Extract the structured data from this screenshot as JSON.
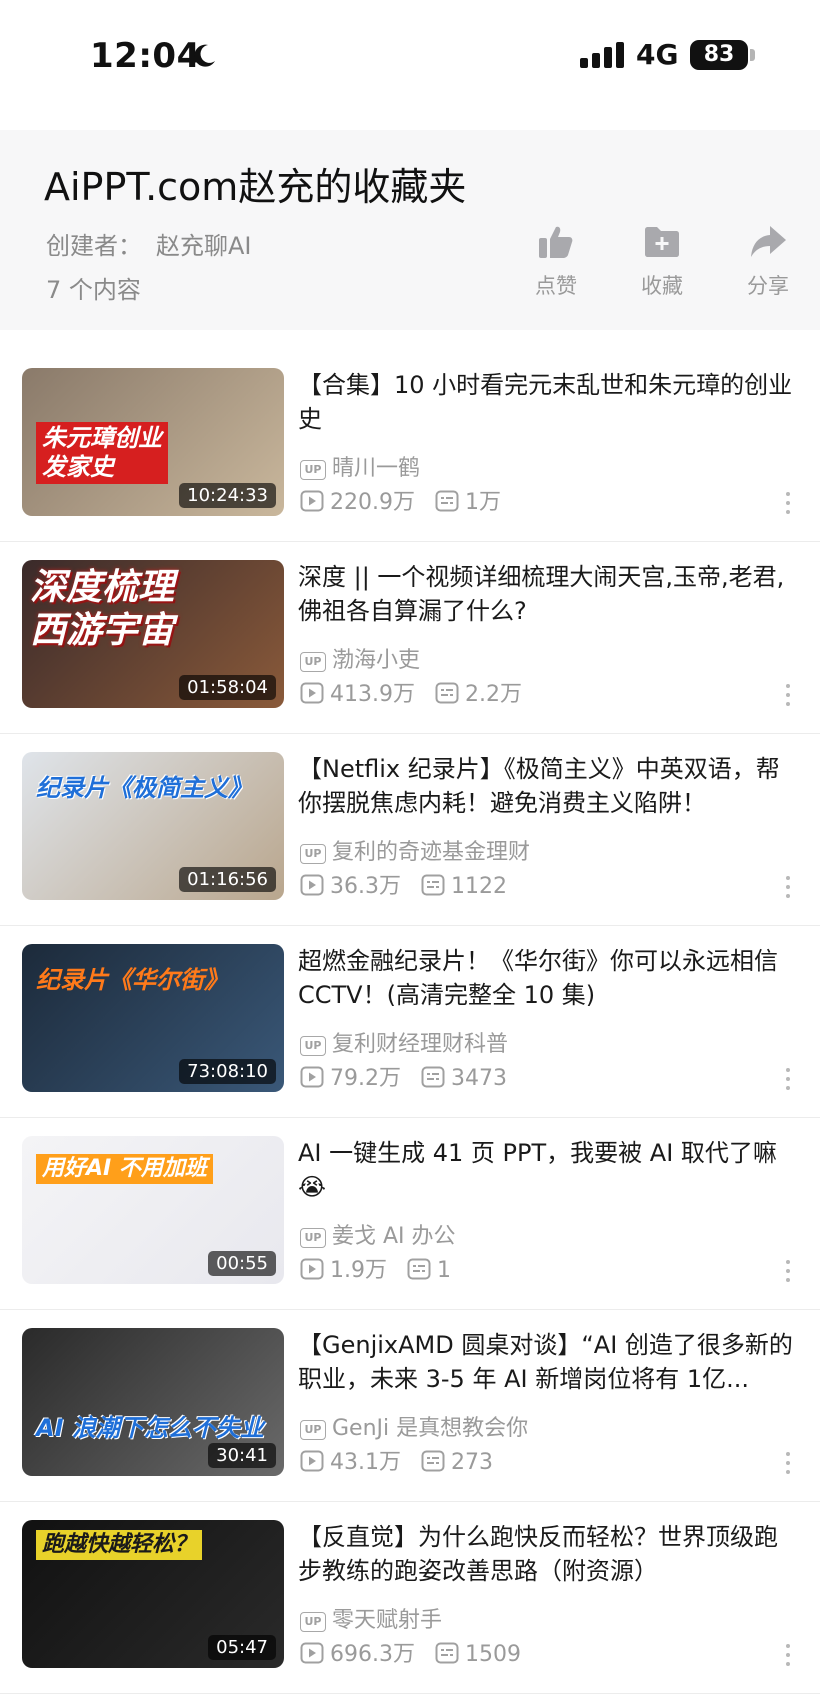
{
  "status_bar": {
    "time": "12:04",
    "network": "4G",
    "battery": "83"
  },
  "header": {
    "title": "AiPPT.com赵充的收藏夹",
    "creator_label": "创建者：",
    "creator_name": "赵充聊AI",
    "item_count": "7 个内容",
    "actions": [
      {
        "label": "点赞",
        "icon": "thumbs-up-icon"
      },
      {
        "label": "收藏",
        "icon": "folder-add-icon"
      },
      {
        "label": "分享",
        "icon": "share-arrow-icon"
      }
    ]
  },
  "videos": [
    {
      "title": "【合集】10 小时看完元末乱世和朱元璋的创业史",
      "uploader": "晴川一鹤",
      "views": "220.9万",
      "comments": "1万",
      "duration": "10:24:33",
      "thumb_caption": "朱元璋创业\n发家史",
      "thumb_colors": [
        "#8a7a6a",
        "#c9b79c"
      ]
    },
    {
      "title": "深度 || 一个视频详细梳理大闹天宫,玉帝,老君,佛祖各自算漏了什么?",
      "uploader": "渤海小吏",
      "views": "413.9万",
      "comments": "2.2万",
      "duration": "01:58:04",
      "thumb_caption": "深度梳理\n西游宇宙",
      "thumb_colors": [
        "#3a2a2a",
        "#8a5a3a"
      ]
    },
    {
      "title": "【Netflix 纪录片】《极简主义》中英双语，帮你摆脱焦虑内耗！避免消费主义陷阱！",
      "uploader": "复利的奇迹基金理财",
      "views": "36.3万",
      "comments": "1122",
      "duration": "01:16:56",
      "thumb_caption": "纪录片《极简主义》",
      "thumb_colors": [
        "#dfe4ea",
        "#b9a68d"
      ]
    },
    {
      "title": "超燃金融纪录片！《华尔街》你可以永远相信 CCTV！(高清完整全 10 集)",
      "uploader": "复利财经理财科普",
      "views": "79.2万",
      "comments": "3473",
      "duration": "73:08:10",
      "thumb_caption": "纪录片《华尔街》",
      "thumb_colors": [
        "#1c2a3a",
        "#3a5878"
      ]
    },
    {
      "title": "AI 一键生成 41 页 PPT，我要被 AI 取代了嘛😭",
      "uploader": "姜戈 AI 办公",
      "views": "1.9万",
      "comments": "1",
      "duration": "00:55",
      "thumb_caption": "用好AI 不用加班",
      "thumb_colors": [
        "#f4f4f6",
        "#e8e8ee"
      ]
    },
    {
      "title": "【GenjixAMD 圆桌对谈】“AI 创造了很多新的职业，未来 3-5 年 AI 新增岗位将有 1亿...",
      "uploader": "GenJi 是真想教会你",
      "views": "43.1万",
      "comments": "273",
      "duration": "30:41",
      "thumb_caption": "AI 浪潮下怎么不失业",
      "thumb_colors": [
        "#2a2a2a",
        "#6a6a6a"
      ]
    },
    {
      "title": "【反直觉】为什么跑快反而轻松？世界顶级跑步教练的跑姿改善思路（附资源）",
      "uploader": "零天赋射手",
      "views": "696.3万",
      "comments": "1509",
      "duration": "05:47",
      "thumb_caption": "跑越快越轻松？",
      "thumb_colors": [
        "#111111",
        "#2a2a2a"
      ]
    }
  ]
}
